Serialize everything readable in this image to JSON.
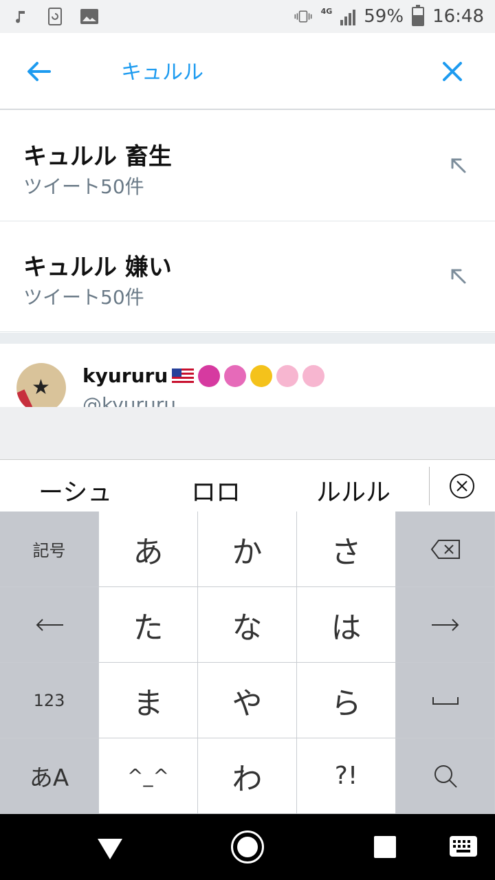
{
  "status": {
    "time": "16:48",
    "battery": "59%",
    "battery_level": 0.59,
    "network": "4G"
  },
  "search": {
    "query": "キュルル",
    "back_icon": "arrow-left-icon",
    "clear_icon": "close-icon",
    "accent": "#1d9bf0"
  },
  "suggestions": [
    {
      "title": "キュルル 畜生",
      "subtitle": "ツイート50件"
    },
    {
      "title": "キュルル 嫌い",
      "subtitle": "ツイート50件"
    }
  ],
  "user_result": {
    "name": "kyururu",
    "handle": "@kyururu"
  },
  "candidates": [
    "ーシュ",
    "ロロ",
    "ルルル"
  ],
  "keyboard": {
    "rows": [
      [
        "記号",
        "あ",
        "か",
        "さ",
        "⌫"
      ],
      [
        "←",
        "た",
        "な",
        "は",
        "→"
      ],
      [
        "123",
        "ま",
        "や",
        "ら",
        "␣"
      ],
      [
        "あA",
        "^_^",
        "わ",
        "?!",
        "🔍"
      ]
    ]
  }
}
